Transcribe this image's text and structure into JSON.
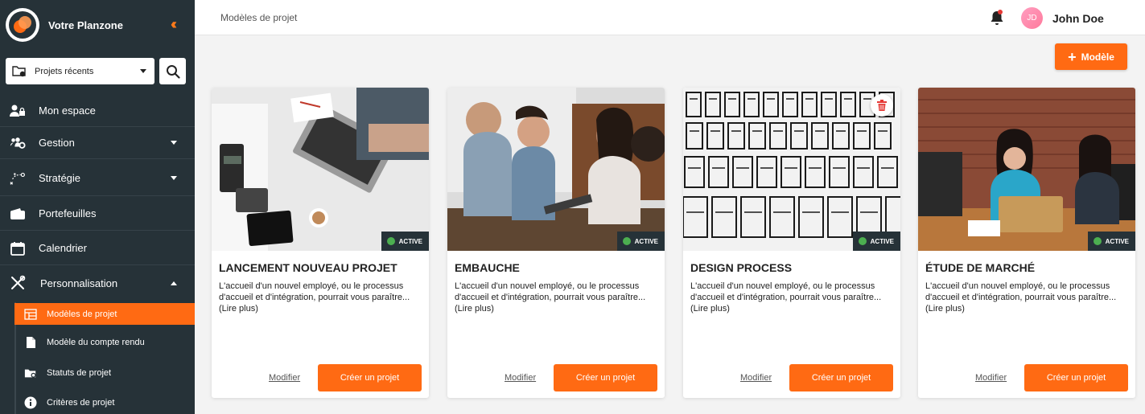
{
  "sidebar": {
    "brand": "Votre Planzone",
    "project_select": "Projets récents",
    "items": [
      {
        "label": "Mon espace",
        "icon": "user-lock-icon"
      },
      {
        "label": "Gestion",
        "icon": "users-gear-icon"
      },
      {
        "label": "Stratégie",
        "icon": "strategy-icon"
      },
      {
        "label": "Portefeuilles",
        "icon": "wallet-icon"
      },
      {
        "label": "Calendrier",
        "icon": "calendar-icon"
      },
      {
        "label": "Personnalisation",
        "icon": "tools-icon"
      }
    ],
    "subitems": [
      {
        "label": "Modèles de projet",
        "icon": "table-layout-icon",
        "active": true
      },
      {
        "label": "Modèle du compte rendu",
        "icon": "document-icon",
        "active": false
      },
      {
        "label": "Statuts de projet",
        "icon": "folder-gear-icon",
        "active": false
      },
      {
        "label": "Critères de projet",
        "icon": "info-icon",
        "active": false
      }
    ]
  },
  "header": {
    "title": "Modèles de projet",
    "user_initials": "JD",
    "user_name": "John Doe"
  },
  "add_button": "Modèle",
  "cards": [
    {
      "title": "LANCEMENT NOUVEAU PROJET",
      "description": "L'accueil d'un nouvel employé, ou le processus d'accueil et d'intégration, pourrait vous paraître...",
      "more": "(Lire plus)",
      "status": "ACTIVE",
      "edit": "Modifier",
      "create": "Créer un projet"
    },
    {
      "title": "EMBAUCHE",
      "description": "L'accueil d'un nouvel employé, ou le processus d'accueil et d'intégration, pourrait vous paraître...",
      "more": "(Lire plus)",
      "status": "ACTIVE",
      "edit": "Modifier",
      "create": "Créer un projet"
    },
    {
      "title": "DESIGN PROCESS",
      "description": "L'accueil d'un nouvel employé, ou le processus d'accueil et d'intégration, pourrait vous paraître...",
      "more": "(Lire plus)",
      "status": "ACTIVE",
      "edit": "Modifier",
      "create": "Créer un projet"
    },
    {
      "title": "ÉTUDE DE MARCHÉ",
      "description": "L'accueil d'un nouvel employé, ou le processus d'accueil et d'intégration, pourrait vous paraître...",
      "more": "(Lire plus)",
      "status": "ACTIVE",
      "edit": "Modifier",
      "create": "Créer un projet"
    }
  ],
  "colors": {
    "accent": "#ff6a13",
    "sidebar": "#263238",
    "status_active": "#4caf50"
  }
}
